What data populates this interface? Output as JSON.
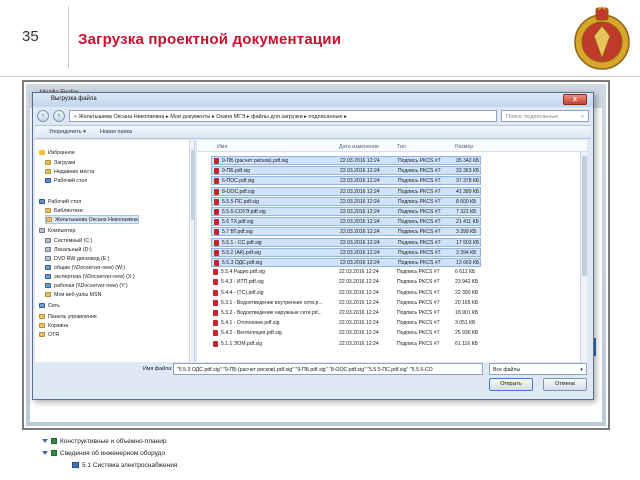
{
  "slide": {
    "number": "35",
    "title": "Загрузка проектной документации"
  },
  "browser": {
    "title": "Mozilla Firefox"
  },
  "tree": [
    {
      "label": "Конструктивные и объемно-планир"
    },
    {
      "label": "Сведения об инженерном оборудо"
    },
    {
      "label": "5.1 Система электроснабжения"
    }
  ],
  "dialog": {
    "title": "Выгрузка файла",
    "close": "x",
    "address": "« Жельтышева Оксана Николаевна  ▸  Мои документы  ▸  Охапа МГЭ  ▸  файлы для загрузки  ▸  подписанные  ▸",
    "search_placeholder": "Поиск: подписанные",
    "toolbar": {
      "organize": "Упорядочить ▾",
      "new_folder": "Новая папка"
    },
    "nav": [
      {
        "label": "Избранное",
        "icon": "star-icon"
      },
      {
        "label": "Загрузки",
        "icon": "folder-icon"
      },
      {
        "label": "Недавние места",
        "icon": "folder-icon"
      },
      {
        "label": "Рабочий стол",
        "icon": "desktop-icon"
      },
      {
        "label": "Рабочий стол",
        "icon": "desktop-icon"
      },
      {
        "label": "Библиотеки",
        "icon": "folder-icon"
      },
      {
        "label": "Жельтышева Оксана Николаевна",
        "icon": "folder-icon",
        "selected": true
      },
      {
        "label": "Компьютер",
        "icon": "drive-icon"
      },
      {
        "label": "Системный (C:)",
        "icon": "drive-icon"
      },
      {
        "label": "Локальный (D:)",
        "icon": "drive-icon"
      },
      {
        "label": "DVD RW дисковод (E:)",
        "icon": "drive-icon"
      },
      {
        "label": "общие (\\\\Docserver-new) (W:)",
        "icon": "net-icon"
      },
      {
        "label": "экспертиза (\\\\Docserver-new) (X:)",
        "icon": "net-icon"
      },
      {
        "label": "рабочая (\\\\Docserver-new) (Y:)",
        "icon": "net-icon"
      },
      {
        "label": "Мои веб-узлы MSN",
        "icon": "folder-icon"
      },
      {
        "label": "Сеть",
        "icon": "net-icon"
      },
      {
        "label": "Панель управления",
        "icon": "folder-icon"
      },
      {
        "label": "Корзина",
        "icon": "folder-icon"
      },
      {
        "label": "OTR",
        "icon": "folder-icon"
      }
    ],
    "columns": {
      "name": "Имя",
      "date": "Дата изменения",
      "type": "Тип",
      "size": "Размер"
    },
    "files": [
      {
        "name": "9-ПБ (расчет рисков).pdf.sig",
        "date": "22.03.2016 12:24",
        "type": "Подпись PKCS #7",
        "size": "35 342 КБ",
        "selected": true
      },
      {
        "name": "9-ПБ.pdf.sig",
        "date": "22.03.2016 12:24",
        "type": "Подпись PKCS #7",
        "size": "33 363 КБ",
        "selected": true
      },
      {
        "name": "6-ПОС.pdf.sig",
        "date": "22.03.2016 12:24",
        "type": "Подпись PKCS #7",
        "size": "37 378 КБ",
        "selected": true
      },
      {
        "name": "8-ООС.pdf.sig",
        "date": "22.03.2016 12:24",
        "type": "Подпись PKCS #7",
        "size": "41 389 КБ",
        "selected": true
      },
      {
        "name": "5.5.5-ПС.pdf.sig",
        "date": "22.03.2016 12:24",
        "type": "Подпись PKCS #7",
        "size": "8 600 КБ",
        "selected": true
      },
      {
        "name": "5.5.6-СОУЭ.pdf.sig",
        "date": "22.03.2016 12:24",
        "type": "Подпись PKCS #7",
        "size": "7 321 КБ",
        "selected": true
      },
      {
        "name": "5.6 ТХ.pdf.sig",
        "date": "22.03.2016 12:24",
        "type": "Подпись PKCS #7",
        "size": "21 411 КБ",
        "selected": true
      },
      {
        "name": "5.7 ВТ.pdf.sig",
        "date": "22.03.2016 12:24",
        "type": "Подпись PKCS #7",
        "size": "3 399 КБ",
        "selected": true
      },
      {
        "name": "5.5.1 - СС.pdf.sig",
        "date": "22.03.2016 12:24",
        "type": "Подпись PKCS #7",
        "size": "17 503 КБ",
        "selected": true
      },
      {
        "name": "5.5.2 (АК).pdf.sig",
        "date": "22.03.2016 12:24",
        "type": "Подпись PKCS #7",
        "size": "3 394 КБ",
        "selected": true
      },
      {
        "name": "5.5.3 ОДС.pdf.sig",
        "date": "22.03.2016 12:24",
        "type": "Подпись PKCS #7",
        "size": "13 663 КБ",
        "selected": true
      },
      {
        "name": "5.5.4 Радио.pdf.sig",
        "date": "22.03.2016 12:24",
        "type": "Подпись PKCS #7",
        "size": "6 612 КБ",
        "selected": false
      },
      {
        "name": "5.4.3 - ИТП.pdf.sig",
        "date": "22.03.2016 12:24",
        "type": "Подпись PKCS #7",
        "size": "23 942 КБ",
        "selected": false
      },
      {
        "name": "5.4.4 - (ТС).pdf.sig",
        "date": "22.03.2016 12:24",
        "type": "Подпись PKCS #7",
        "size": "22 390 КБ",
        "selected": false
      },
      {
        "name": "5.3.1 - Водоотведение внутренние сети.p...",
        "date": "22.03.2016 12:24",
        "type": "Подпись PKCS #7",
        "size": "20 165 КБ",
        "selected": false
      },
      {
        "name": "5.3.2 - Водоотведение наружные сети.pd...",
        "date": "22.03.2016 12:24",
        "type": "Подпись PKCS #7",
        "size": "18 901 КБ",
        "selected": false
      },
      {
        "name": "5.4.1 - Отопление.pdf.sig",
        "date": "22.03.2016 12:24",
        "type": "Подпись PKCS #7",
        "size": "3 051 КБ",
        "selected": false
      },
      {
        "name": "5.4.2 - Вентиляция.pdf.sig",
        "date": "22.03.2016 12:24",
        "type": "Подпись PKCS #7",
        "size": "25 936 КБ",
        "selected": false
      },
      {
        "name": "5.1.1 ЭОМ.pdf.sig",
        "date": "22.03.2016 12:24",
        "type": "Подпись PKCS #7",
        "size": "61 116 КБ",
        "selected": false
      }
    ],
    "filename_label": "Имя файла:",
    "filename_value": "\"5.5.3 ОДС.pdf.sig\" \"9-ПБ (расчет рисков).pdf.sig\" \"9-ПБ.pdf.sig\" \"8-ООС.pdf.sig\" \"5.5.5-ПС.pdf.sig\" \"5.5.6-СО",
    "filetype": "Все файлы",
    "open_button": "Открыть",
    "cancel_button": "Отмена"
  },
  "colors": {
    "title_red": "#c8102e",
    "selection_blue": "#cfe2f7"
  }
}
